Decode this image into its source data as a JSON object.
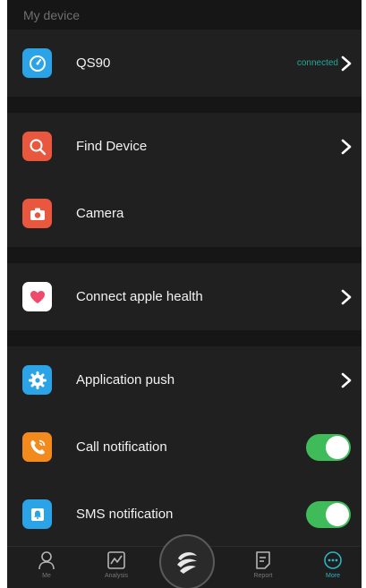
{
  "section_header": "My device",
  "device": {
    "name": "QS90",
    "status": "connected"
  },
  "menu": {
    "find_device": "Find Device",
    "camera": "Camera",
    "apple_health": "Connect apple health",
    "app_push": "Application push",
    "call_notification": {
      "label": "Call notification",
      "enabled": true
    },
    "sms_notification": {
      "label": "SMS notification",
      "enabled": true
    }
  },
  "tabs": [
    {
      "label": "Me",
      "icon": "person-icon",
      "active": false
    },
    {
      "label": "Analysis",
      "icon": "chart-icon",
      "active": false
    },
    {
      "label": "",
      "icon": "sport-logo-icon",
      "active": false
    },
    {
      "label": "Report",
      "icon": "report-icon",
      "active": false
    },
    {
      "label": "More",
      "icon": "more-icon",
      "active": true
    }
  ],
  "colors": {
    "accent": "#2fb3c4",
    "toggle_on": "#3fbb5a",
    "watch_tile": "#2aa4e6",
    "find_tile": "#e9573f",
    "camera_tile": "#e9573f",
    "push_tile": "#2aa4e6",
    "call_tile": "#f28a1e",
    "sms_tile": "#2aa4e6"
  }
}
